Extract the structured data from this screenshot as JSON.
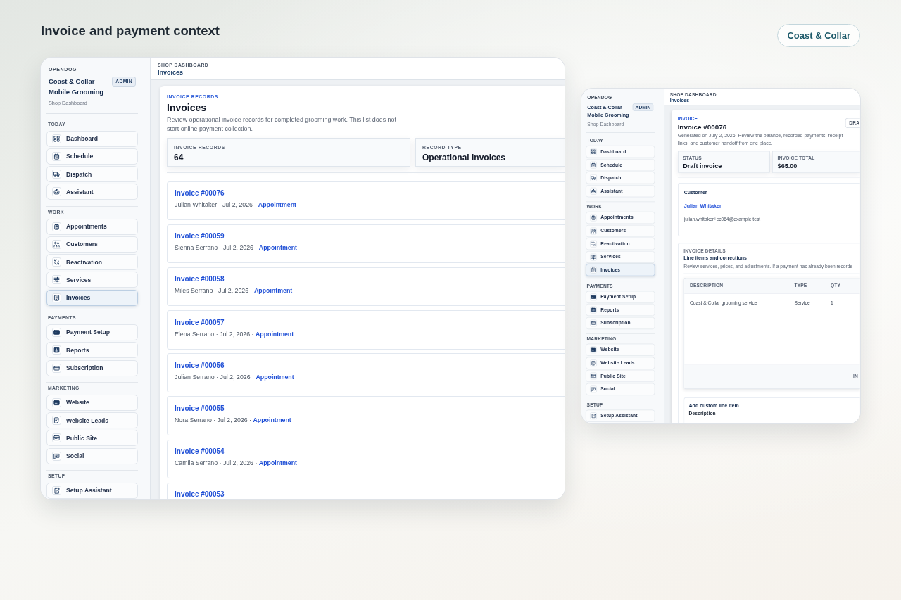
{
  "page": {
    "title": "Invoice and payment context",
    "badge": "Coast & Collar"
  },
  "windows": [
    {
      "kind": "invoice_list",
      "sidebar": {
        "brand": "OPENDOG",
        "shop_name": "Coast & Collar Mobile Grooming",
        "role_badge": "ADMIN",
        "subtitle": "Shop Dashboard",
        "sections": [
          {
            "label": "TODAY",
            "items": [
              {
                "label": "Dashboard",
                "selected": false
              },
              {
                "label": "Schedule",
                "selected": false
              },
              {
                "label": "Dispatch",
                "selected": false
              },
              {
                "label": "Assistant",
                "selected": false
              }
            ]
          },
          {
            "label": "WORK",
            "items": [
              {
                "label": "Appointments",
                "selected": false
              },
              {
                "label": "Customers",
                "selected": false
              },
              {
                "label": "Reactivation",
                "selected": false
              },
              {
                "label": "Services",
                "selected": false
              },
              {
                "label": "Invoices",
                "selected": true
              }
            ]
          },
          {
            "label": "PAYMENTS",
            "items": [
              {
                "label": "Payment Setup",
                "selected": false
              },
              {
                "label": "Reports",
                "selected": false
              },
              {
                "label": "Subscription",
                "selected": false
              }
            ]
          },
          {
            "label": "MARKETING",
            "items": [
              {
                "label": "Website",
                "selected": false
              },
              {
                "label": "Website Leads",
                "selected": false
              },
              {
                "label": "Public Site",
                "selected": false
              },
              {
                "label": "Social",
                "selected": false
              }
            ]
          },
          {
            "label": "SETUP",
            "items": [
              {
                "label": "Setup Assistant",
                "selected": false
              }
            ]
          }
        ]
      },
      "header": {
        "eyebrow": "SHOP DASHBOARD",
        "title": "Invoices"
      },
      "records": {
        "eyebrow": "INVOICE RECORDS",
        "title": "Invoices",
        "description": "Review operational invoice records for completed grooming work. This list does not start online payment collection.",
        "stats": [
          {
            "label": "INVOICE RECORDS",
            "value": "64"
          },
          {
            "label": "RECORD TYPE",
            "value": "Operational invoices"
          }
        ],
        "invoices": [
          {
            "title": "Invoice #00076",
            "meta": "Julian Whitaker · Jul 2, 2026 ·",
            "link": "Appointment"
          },
          {
            "title": "Invoice #00059",
            "meta": "Sienna Serrano · Jul 2, 2026 ·",
            "link": "Appointment"
          },
          {
            "title": "Invoice #00058",
            "meta": "Miles Serrano · Jul 2, 2026 ·",
            "link": "Appointment"
          },
          {
            "title": "Invoice #00057",
            "meta": "Elena Serrano · Jul 2, 2026 ·",
            "link": "Appointment"
          },
          {
            "title": "Invoice #00056",
            "meta": "Julian Serrano · Jul 2, 2026 ·",
            "link": "Appointment"
          },
          {
            "title": "Invoice #00055",
            "meta": "Nora Serrano · Jul 2, 2026 ·",
            "link": "Appointment"
          },
          {
            "title": "Invoice #00054",
            "meta": "Camila Serrano · Jul 2, 2026 ·",
            "link": "Appointment"
          },
          {
            "title": "Invoice #00053"
          }
        ]
      }
    },
    {
      "kind": "invoice_detail",
      "sidebar": {
        "brand": "OPENDOG",
        "shop_name": "Coast & Collar Mobile Grooming",
        "role_badge": "ADMIN",
        "subtitle": "Shop Dashboard",
        "sections": [
          {
            "label": "TODAY",
            "items": [
              {
                "label": "Dashboard",
                "selected": false
              },
              {
                "label": "Schedule",
                "selected": false
              },
              {
                "label": "Dispatch",
                "selected": false
              },
              {
                "label": "Assistant",
                "selected": false
              }
            ]
          },
          {
            "label": "WORK",
            "items": [
              {
                "label": "Appointments",
                "selected": false
              },
              {
                "label": "Customers",
                "selected": false
              },
              {
                "label": "Reactivation",
                "selected": false
              },
              {
                "label": "Services",
                "selected": false
              },
              {
                "label": "Invoices",
                "selected": true
              }
            ]
          },
          {
            "label": "PAYMENTS",
            "items": [
              {
                "label": "Payment Setup",
                "selected": false
              },
              {
                "label": "Reports",
                "selected": false
              },
              {
                "label": "Subscription",
                "selected": false
              }
            ]
          },
          {
            "label": "MARKETING",
            "items": [
              {
                "label": "Website",
                "selected": false
              },
              {
                "label": "Website Leads",
                "selected": false
              },
              {
                "label": "Public Site",
                "selected": false
              },
              {
                "label": "Social",
                "selected": false
              }
            ]
          },
          {
            "label": "SETUP",
            "items": [
              {
                "label": "Setup Assistant",
                "selected": false
              }
            ]
          }
        ]
      },
      "header": {
        "eyebrow": "SHOP DASHBOARD",
        "title": "Invoices"
      },
      "invoice": {
        "eyebrow": "INVOICE",
        "title": "Invoice #00076",
        "status_button": "DRA",
        "description": "Generated on July 2, 2026. Review the balance, recorded payments, receipt links, and customer handoff from one place.",
        "stats": [
          {
            "label": "STATUS",
            "value": "Draft invoice"
          },
          {
            "label": "INVOICE TOTAL",
            "value": "$65.00"
          }
        ],
        "customer": {
          "heading": "Customer",
          "name": "Julian Whitaker",
          "email": "julian.whitaker+cc064@example.test"
        },
        "line_items": {
          "eyebrow": "INVOICE DETAILS",
          "title": "Line items and corrections",
          "description": "Review services, prices, and adjustments. If a payment has already been recorde",
          "table": {
            "columns": [
              "DESCRIPTION",
              "TYPE",
              "QTY"
            ],
            "rows": [
              [
                "Coast & Collar grooming service",
                "Service",
                "1"
              ]
            ],
            "footer": "IN"
          }
        },
        "custom_line_item": {
          "title": "Add custom line item",
          "field_label": "Description"
        }
      }
    }
  ]
}
